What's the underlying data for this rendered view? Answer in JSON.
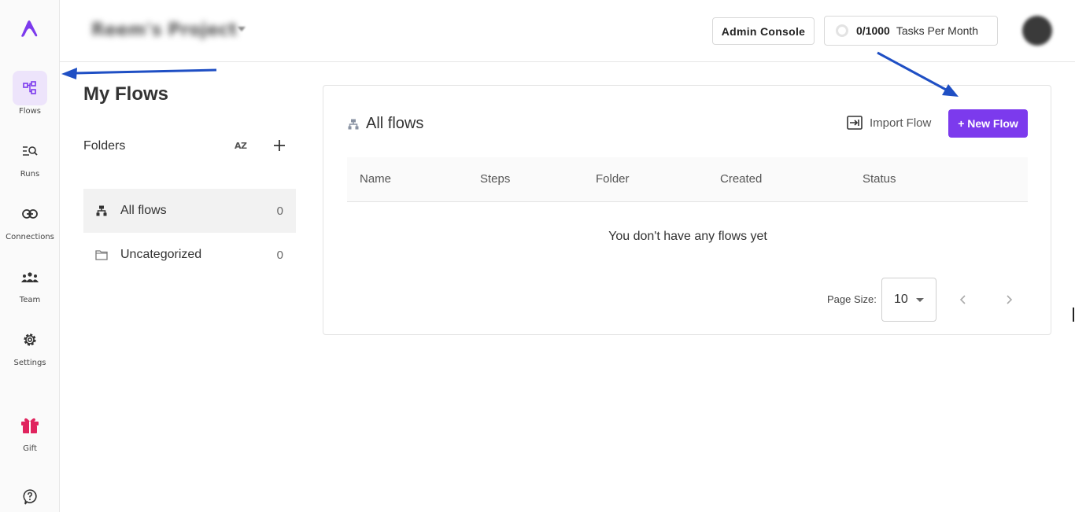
{
  "sidebar": {
    "items": [
      {
        "label": "Flows",
        "icon": "flows-icon",
        "active": true
      },
      {
        "label": "Runs",
        "icon": "runs-icon"
      },
      {
        "label": "Connections",
        "icon": "link-icon"
      },
      {
        "label": "Team",
        "icon": "team-icon"
      },
      {
        "label": "Settings",
        "icon": "gear-icon"
      },
      {
        "label": "Gift",
        "icon": "gift-icon"
      }
    ],
    "help_icon": "help-icon"
  },
  "header": {
    "project_name": "Reem's Project",
    "admin_console_label": "Admin Console",
    "tasks_count": "0/1000",
    "tasks_label": "Tasks Per Month"
  },
  "folders": {
    "page_title": "My Flows",
    "section_label": "Folders",
    "sort_icon_text": "AZ",
    "items": [
      {
        "name": "All flows",
        "count": "0",
        "icon": "flow-tree-icon",
        "active": true
      },
      {
        "name": "Uncategorized",
        "count": "0",
        "icon": "folder-icon"
      }
    ]
  },
  "main": {
    "title": "All flows",
    "import_label": "Import Flow",
    "new_flow_label": "+ New Flow",
    "columns": [
      "Name",
      "Steps",
      "Folder",
      "Created",
      "Status"
    ],
    "empty_message": "You don't have any flows yet",
    "page_size_label": "Page Size:",
    "page_size_value": "10"
  },
  "colors": {
    "accent": "#7c3aed",
    "active_bg": "#ede4fb",
    "annotation_arrow": "#1f4fc4"
  }
}
